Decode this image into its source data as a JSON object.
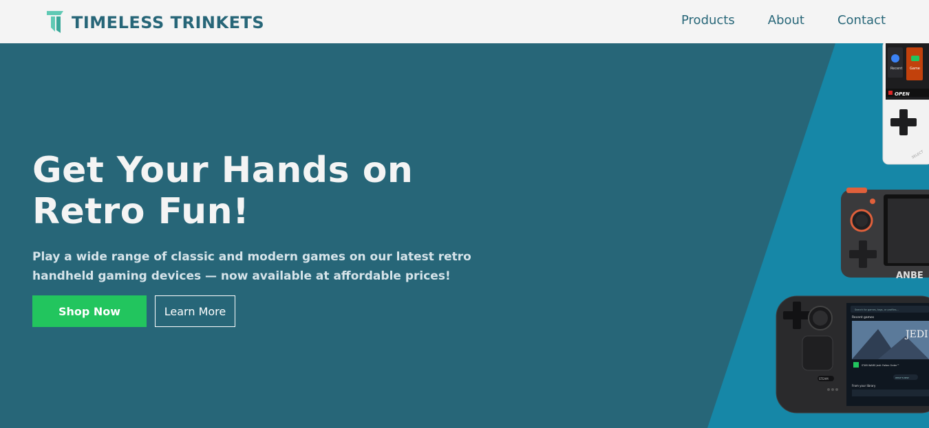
{
  "brand": {
    "name": "TIMELESS TRINKETS",
    "logo_icon": "tt-logo-icon"
  },
  "nav": {
    "items": [
      {
        "label": "Products"
      },
      {
        "label": "About"
      },
      {
        "label": "Contact"
      }
    ]
  },
  "hero": {
    "title": "Get Your Hands on Retro Fun!",
    "subtitle": "Play a wide range of classic and modern games on our latest retro handheld gaming devices — now available at affordable prices!",
    "primary_button": "Shop Now",
    "secondary_button": "Learn More"
  },
  "devices": {
    "top": {
      "open_label": "OPEN",
      "app1": "Recent",
      "app2": "Game"
    },
    "middle": {
      "brand_text": "ANBE"
    },
    "bottom": {
      "search_placeholder": "Search for games, tags, or profiles...",
      "recent_label": "Recent games",
      "game_title": "JEDI",
      "game_caption": "STAR WARS Jedi: Fallen Order™",
      "library_label": "From your library",
      "steam_label": "STEAM",
      "whats_new": "WHAT'S NEW"
    }
  },
  "colors": {
    "nav_bg": "#f4f4f4",
    "hero_bg": "#276678",
    "accent_diag": "#1687a7",
    "brand": "#276678",
    "cta": "#22c55e"
  }
}
